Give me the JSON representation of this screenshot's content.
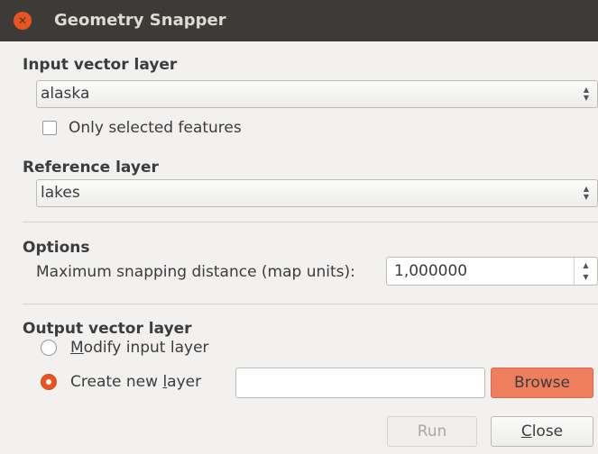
{
  "window": {
    "title": "Geometry Snapper"
  },
  "input_layer": {
    "label": "Input vector layer",
    "value": "alaska",
    "only_selected_label": "Only selected features",
    "only_selected_checked": false
  },
  "reference_layer": {
    "label": "Reference layer",
    "value": "lakes"
  },
  "options": {
    "label": "Options",
    "distance_label": "Maximum snapping distance (map units):",
    "distance_value": "1,000000"
  },
  "output": {
    "label": "Output vector layer",
    "modify_label_prefix": "M",
    "modify_label_rest": "odify input layer",
    "create_label_prefix": "Create new ",
    "create_label_ul": "l",
    "create_label_rest": "ayer",
    "selected": "create_new",
    "path_value": "",
    "browse_label": "Browse"
  },
  "buttons": {
    "run_label": "Run",
    "close_prefix": "C",
    "close_rest": "lose"
  },
  "colors": {
    "accent": "#e95420",
    "titlebar": "#3c3b37"
  }
}
